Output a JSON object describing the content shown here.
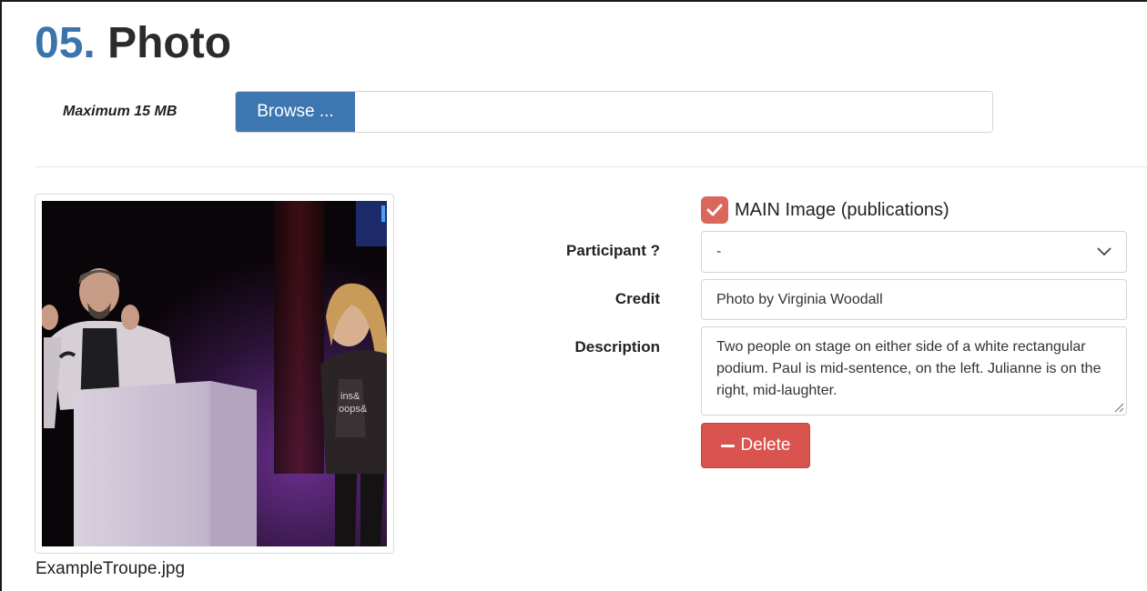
{
  "section": {
    "number": "05.",
    "title": "Photo"
  },
  "upload": {
    "max_size_label": "Maximum 15 MB",
    "browse_label": "Browse ...",
    "file_value": ""
  },
  "photo": {
    "filename": "ExampleTroupe.jpg"
  },
  "form": {
    "main_image_label": "MAIN Image (publications)",
    "main_image_checked": true,
    "participant_label": "Participant ?",
    "participant_value": "-",
    "credit_label": "Credit",
    "credit_value": "Photo by Virginia Woodall",
    "description_label": "Description",
    "description_value": "Two people on stage on either side of a white rectangular podium. Paul is mid-sentence, on the left. Julianne is on the right, mid-laughter.",
    "delete_label": "Delete"
  },
  "colors": {
    "accent_blue": "#3d76b0",
    "checkbox": "#d9675a",
    "danger": "#d9534f"
  }
}
